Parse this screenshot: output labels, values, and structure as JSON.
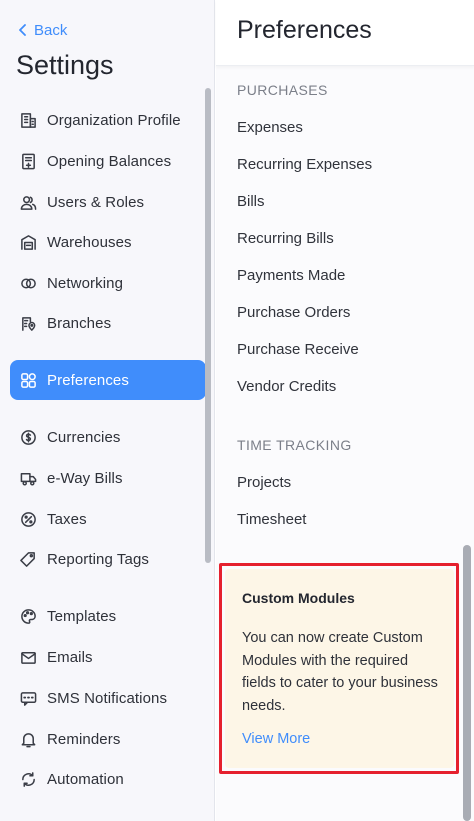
{
  "sidebar": {
    "back_label": "Back",
    "title": "Settings",
    "active_color": "#408dfb",
    "items": [
      {
        "label": "Organization Profile",
        "icon": "building-icon"
      },
      {
        "label": "Opening Balances",
        "icon": "ledger-icon"
      },
      {
        "label": "Users & Roles",
        "icon": "users-icon"
      },
      {
        "label": "Warehouses",
        "icon": "warehouse-icon"
      },
      {
        "label": "Networking",
        "icon": "link-rings-icon"
      },
      {
        "label": "Branches",
        "icon": "branch-location-icon"
      },
      {
        "label": "Preferences",
        "icon": "grid-preferences-icon",
        "active": true
      },
      {
        "label": "Currencies",
        "icon": "currency-icon"
      },
      {
        "label": "e-Way Bills",
        "icon": "truck-icon"
      },
      {
        "label": "Taxes",
        "icon": "percent-icon"
      },
      {
        "label": "Reporting Tags",
        "icon": "tag-icon"
      },
      {
        "label": "Templates",
        "icon": "palette-icon"
      },
      {
        "label": "Emails",
        "icon": "mail-icon"
      },
      {
        "label": "SMS Notifications",
        "icon": "sms-icon"
      },
      {
        "label": "Reminders",
        "icon": "bell-icon"
      },
      {
        "label": "Automation",
        "icon": "refresh-icon"
      }
    ]
  },
  "preferences": {
    "title": "Preferences",
    "sections": [
      {
        "heading": "PURCHASES",
        "items": [
          "Expenses",
          "Recurring Expenses",
          "Bills",
          "Recurring Bills",
          "Payments Made",
          "Purchase Orders",
          "Purchase Receive",
          "Vendor Credits"
        ]
      },
      {
        "heading": "TIME TRACKING",
        "items": [
          "Projects",
          "Timesheet"
        ]
      }
    ]
  },
  "custom_modules_card": {
    "title": "Custom Modules",
    "text": "You can now create Custom Modules with the required fields to cater to your business needs.",
    "link": "View More",
    "highlight_color": "#e5202e",
    "background": "#fdf6e7"
  }
}
